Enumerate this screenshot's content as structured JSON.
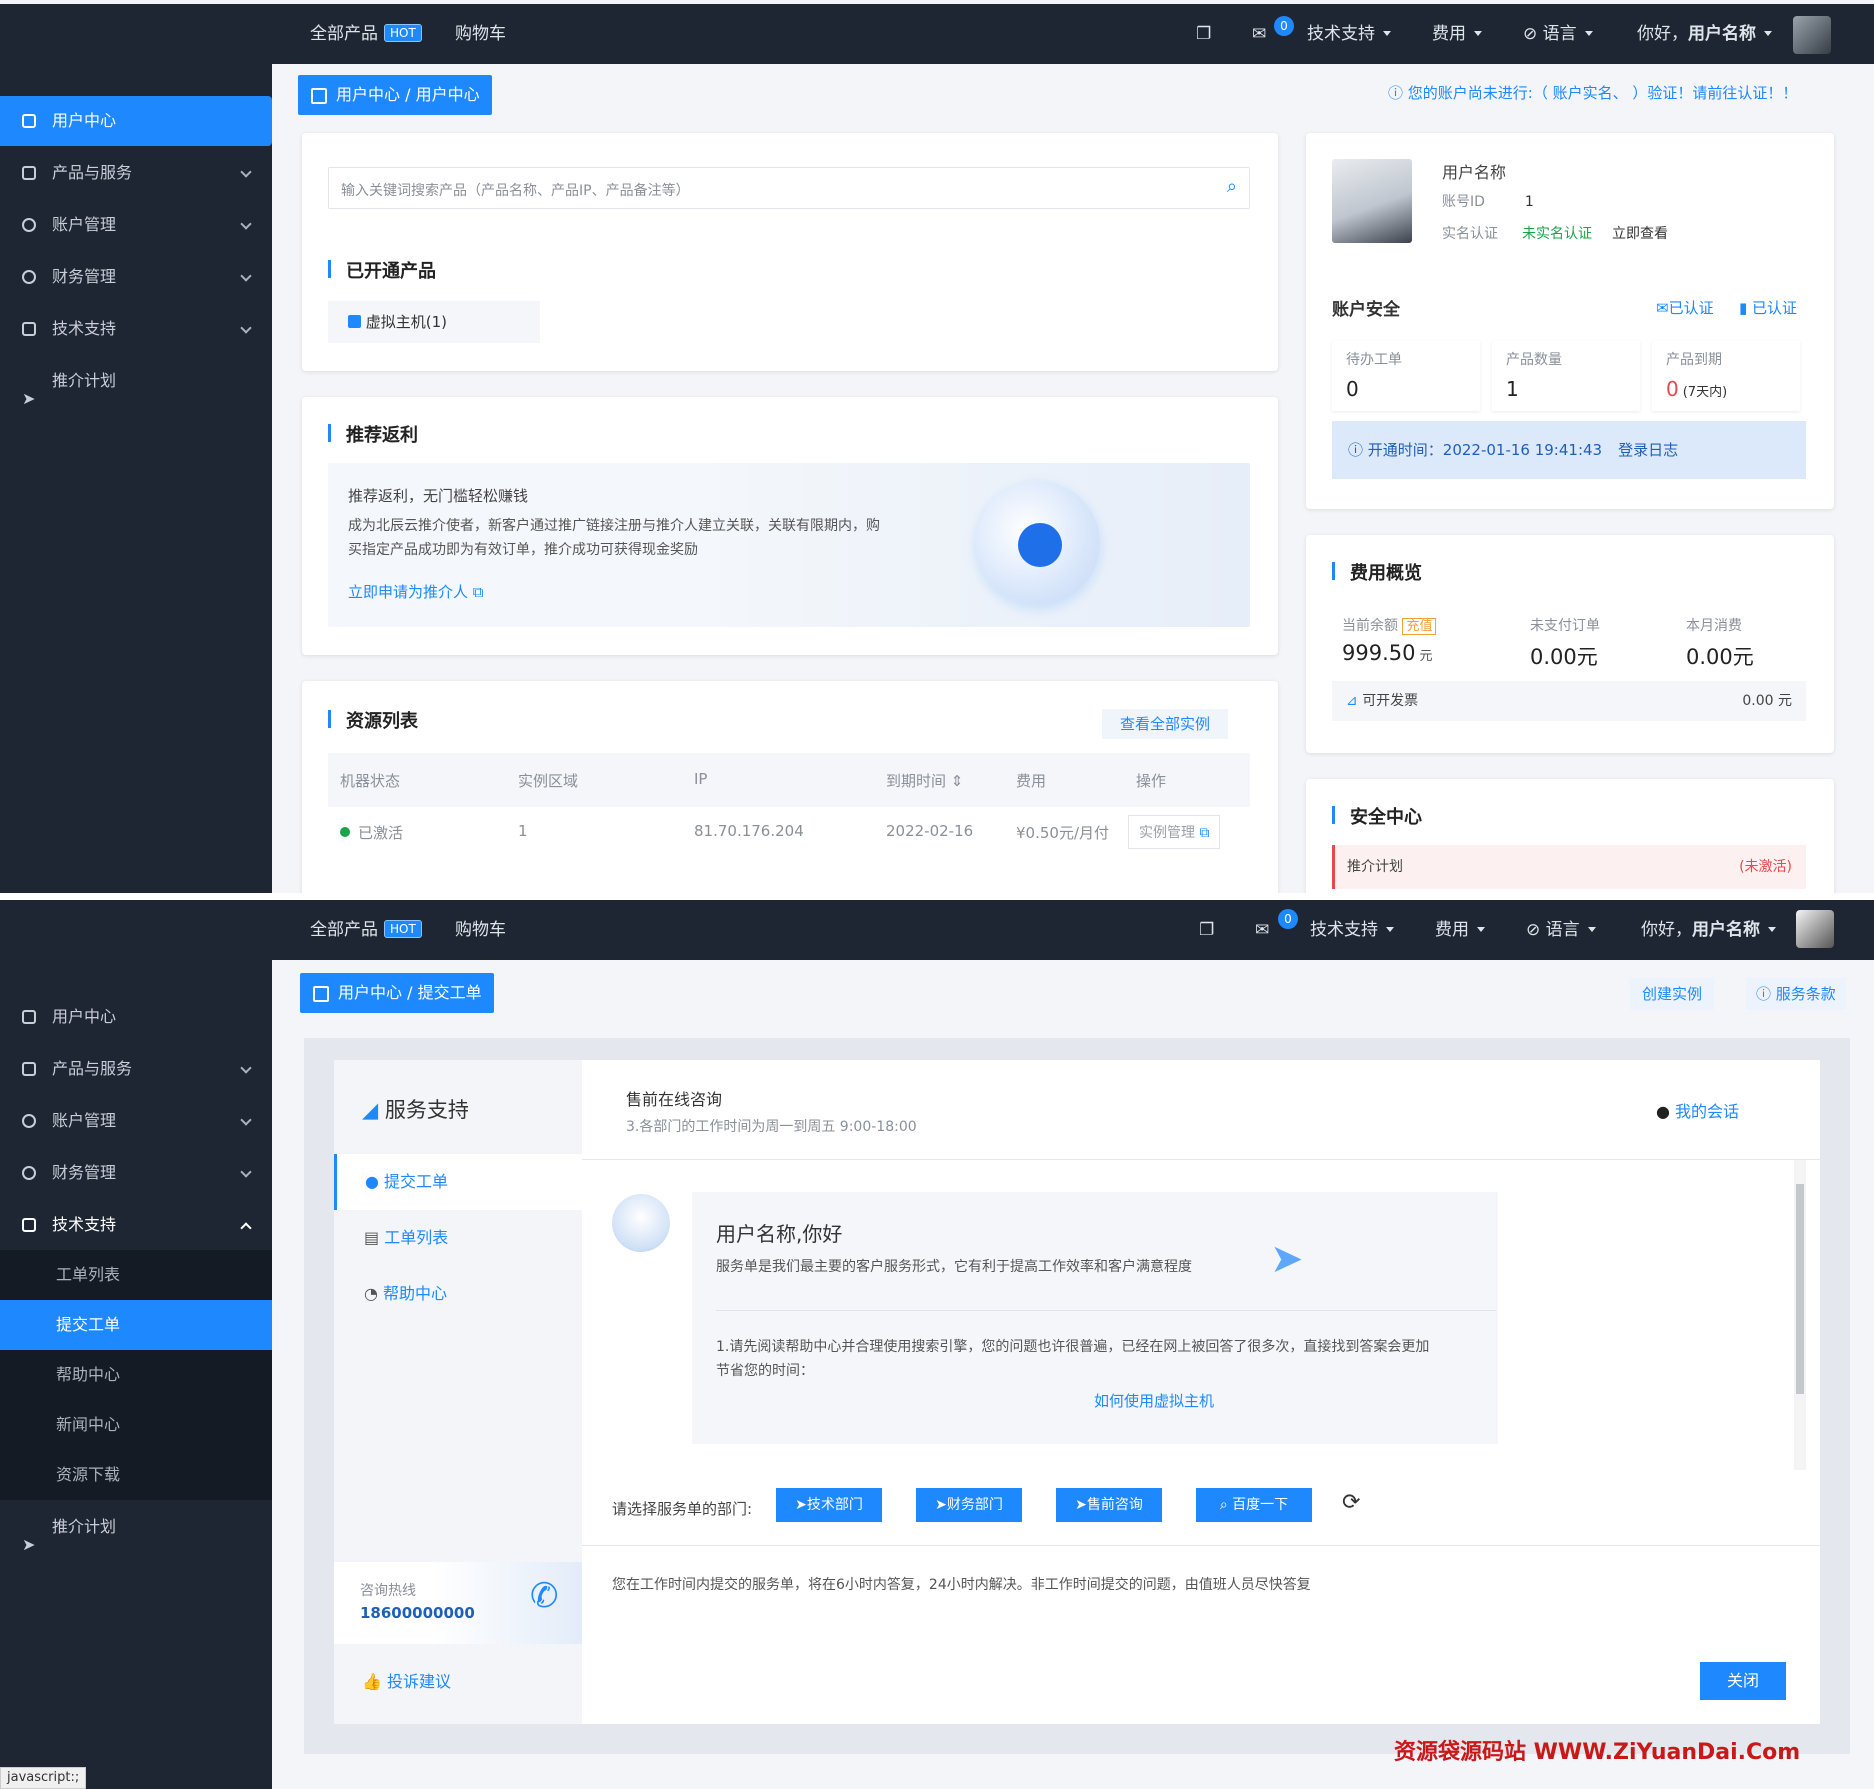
{
  "top": {
    "all_products": "全部产品",
    "hot": "HOT",
    "cart": "购物车",
    "msg_count": "0",
    "support": "技术支持",
    "fees": "费用",
    "lang": "语言",
    "greeting": "你好，",
    "username": "用户名称"
  },
  "sidebar": {
    "items": [
      {
        "label": "用户中心"
      },
      {
        "label": "产品与服务"
      },
      {
        "label": "账户管理"
      },
      {
        "label": "财务管理"
      },
      {
        "label": "技术支持"
      },
      {
        "label": "推介计划"
      }
    ],
    "support_sub": [
      "工单列表",
      "提交工单",
      "帮助中心",
      "新闻中心",
      "资源下载"
    ]
  },
  "page1": {
    "breadcrumb": "用户中心 / 用户中心",
    "notice": "您的账户尚未进行:（ 账户实名、 ）验证！请前往认证！！",
    "search_placeholder": "输入关键词搜索产品（产品名称、产品IP、产品备注等）",
    "opened_title": "已开通产品",
    "opened_item": "虚拟主机(1)",
    "rebate_title": "推荐返利",
    "rebate_heading": "推荐返利，无门槛轻松赚钱",
    "rebate_line1": "成为北辰云推介使者，新客户通过推广链接注册与推介人建立关联，关联有限期内，购",
    "rebate_line2": "买指定产品成功即为有效订单，推介成功可获得现金奖励",
    "rebate_link": "立即申请为推介人",
    "res_title": "资源列表",
    "res_view_all": "查看全部实例",
    "res_headers": [
      "机器状态",
      "实例区域",
      "IP",
      "到期时间",
      "费用",
      "操作"
    ],
    "res_row": {
      "status": "已激活",
      "region": "1",
      "ip": "81.70.176.204",
      "expire": "2022-02-16",
      "fee": "¥0.50元/月付",
      "action": "实例管理"
    },
    "profile": {
      "name": "用户名称",
      "id_label": "账号ID",
      "id_value": "1",
      "verify_label": "实名认证",
      "verify_status": "未实名认证",
      "verify_link": "立即查看"
    },
    "security_title": "账户安全",
    "email_verified": "已认证",
    "phone_verified": "已认证",
    "stats": [
      {
        "label": "待办工单",
        "value": "0",
        "extra": ""
      },
      {
        "label": "产品数量",
        "value": "1",
        "extra": ""
      },
      {
        "label": "产品到期",
        "value": "0",
        "extra": "(7天内)"
      }
    ],
    "open_time": "开通时间：2022-01-16 19:41:43",
    "login_log": "登录日志",
    "fee_title": "费用概览",
    "balance_label": "当前余额",
    "recharge": "充值",
    "balance_value": "999.50",
    "balance_unit": "元",
    "unpaid_label": "未支付订单",
    "unpaid_value": "0.00元",
    "month_label": "本月消费",
    "month_value": "0.00元",
    "invoice_label": "可开发票",
    "invoice_value": "0.00 元",
    "safe_title": "安全中心",
    "safe_item": "推介计划",
    "safe_status": "(未激活)"
  },
  "page2": {
    "breadcrumb": "用户中心 / 提交工单",
    "create_instance": "创建实例",
    "terms": "服务条款",
    "brand": "服务支持",
    "nav": [
      "提交工单",
      "工单列表",
      "帮助中心"
    ],
    "hotline_label": "咨询热线",
    "hotline": "18600000000",
    "complaint": "投诉建议",
    "consult_title": "售前在线咨询",
    "consult_sub": "3.各部门的工作时间为周一到周五 9:00-18:00",
    "my_chat": "我的会话",
    "hello": "用户名称,你好",
    "hello_desc": "服务单是我们最主要的客户服务形式，它有利于提高工作效率和客户满意程度",
    "tip_line1": "1.请先阅读帮助中心并合理使用搜索引擎，您的问题也许很普遍，已经在网上被回答了很多次，直接找到答案会更加",
    "tip_line2": "节省您的时间：",
    "tip_link": "如何使用虚拟主机",
    "dept_label": "请选择服务单的部门:",
    "depts": [
      "技术部门",
      "财务部门",
      "售前咨询",
      "百度一下"
    ],
    "footer_note": "您在工作时间内提交的服务单，将在6小时内答复，24小时内解决。非工作时间提交的问题，由值班人员尽快答复",
    "close": "关闭",
    "status_bar": "javascript:;"
  },
  "watermark": "资源袋源码站 WWW.ZiYuanDai.Com",
  "colors": {
    "accent": "#1e88ff",
    "dark": "#1f2633",
    "success": "#1aa34a",
    "danger": "#e5484d"
  }
}
